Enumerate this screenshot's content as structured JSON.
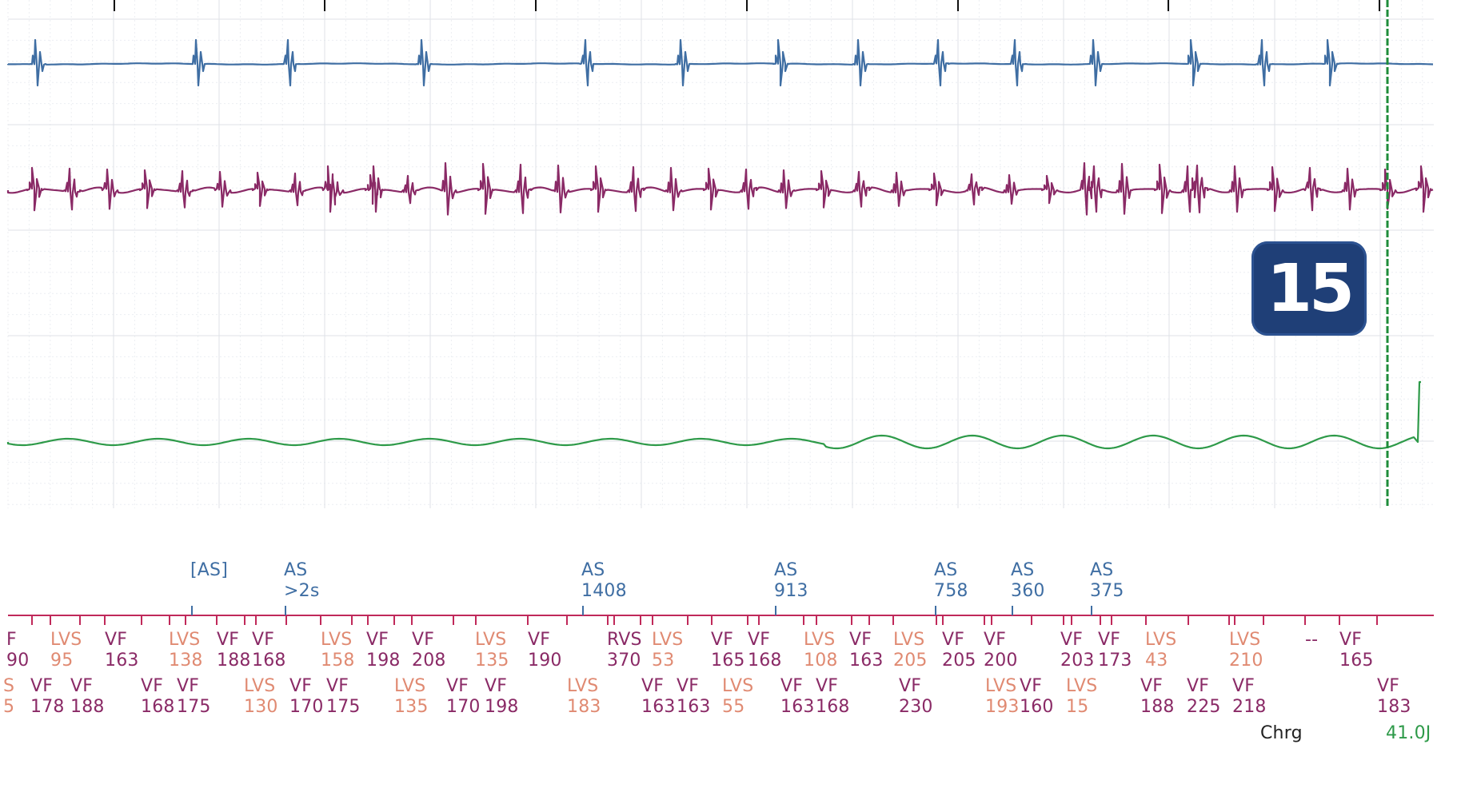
{
  "badge_number": "15",
  "colors": {
    "atrial_egm": "#3f6ea3",
    "ventricular_egm": "#8a2a66",
    "shock_egm": "#2e9a49",
    "marker_axis": "#c0295a",
    "charge_line": "#1e8c3a",
    "badge_bg": "#1f3f77"
  },
  "atrial_markers": [
    {
      "label": "[AS]",
      "value": ""
    },
    {
      "label": "AS",
      "value": ">2s"
    },
    {
      "label": "AS",
      "value": "1408"
    },
    {
      "label": "AS",
      "value": "913"
    },
    {
      "label": "AS",
      "value": "758"
    },
    {
      "label": "AS",
      "value": "360"
    },
    {
      "label": "AS",
      "value": "375"
    }
  ],
  "ventricular_row1": [
    {
      "label": "F",
      "value": "90"
    },
    {
      "label": "LVS",
      "value": "95"
    },
    {
      "label": "VF",
      "value": "163"
    },
    {
      "label": "LVS",
      "value": "138"
    },
    {
      "label": "VF",
      "value": "188"
    },
    {
      "label": "VF",
      "value": "168"
    },
    {
      "label": "LVS",
      "value": "158"
    },
    {
      "label": "VF",
      "value": "198"
    },
    {
      "label": "VF",
      "value": "208"
    },
    {
      "label": "LVS",
      "value": "135"
    },
    {
      "label": "VF",
      "value": "190"
    },
    {
      "label": "RVS",
      "value": "370"
    },
    {
      "label": "LVS",
      "value": "53"
    },
    {
      "label": "VF",
      "value": "165"
    },
    {
      "label": "VF",
      "value": "168"
    },
    {
      "label": "LVS",
      "value": "108"
    },
    {
      "label": "VF",
      "value": "163"
    },
    {
      "label": "LVS",
      "value": "205"
    },
    {
      "label": "VF",
      "value": "205"
    },
    {
      "label": "VF",
      "value": "200"
    },
    {
      "label": "VF",
      "value": "203"
    },
    {
      "label": "VF",
      "value": "173"
    },
    {
      "label": "LVS",
      "value": "43"
    },
    {
      "label": "LVS",
      "value": "210"
    },
    {
      "label": "--",
      "value": ""
    },
    {
      "label": "VF",
      "value": "165"
    }
  ],
  "ventricular_row2": [
    {
      "label": "S",
      "value": "5"
    },
    {
      "label": "VF",
      "value": "178"
    },
    {
      "label": "VF",
      "value": "188"
    },
    {
      "label": "VF",
      "value": "168"
    },
    {
      "label": "VF",
      "value": "175"
    },
    {
      "label": "LVS",
      "value": "130"
    },
    {
      "label": "VF",
      "value": "170"
    },
    {
      "label": "VF",
      "value": "175"
    },
    {
      "label": "LVS",
      "value": "135"
    },
    {
      "label": "VF",
      "value": "170"
    },
    {
      "label": "VF",
      "value": "198"
    },
    {
      "label": "LVS",
      "value": "183"
    },
    {
      "label": "VF",
      "value": "163"
    },
    {
      "label": "VF",
      "value": "163"
    },
    {
      "label": "LVS",
      "value": "55"
    },
    {
      "label": "VF",
      "value": "163"
    },
    {
      "label": "VF",
      "value": "168"
    },
    {
      "label": "VF",
      "value": "230"
    },
    {
      "label": "LVS",
      "value": "193"
    },
    {
      "label": "VF",
      "value": "160"
    },
    {
      "label": "LVS",
      "value": "15"
    },
    {
      "label": "VF",
      "value": "188"
    },
    {
      "label": "VF",
      "value": "225"
    },
    {
      "label": "VF",
      "value": "218"
    },
    {
      "label": "VF",
      "value": "183"
    }
  ],
  "charge": {
    "label": "Chrg",
    "value": "41.0J"
  }
}
